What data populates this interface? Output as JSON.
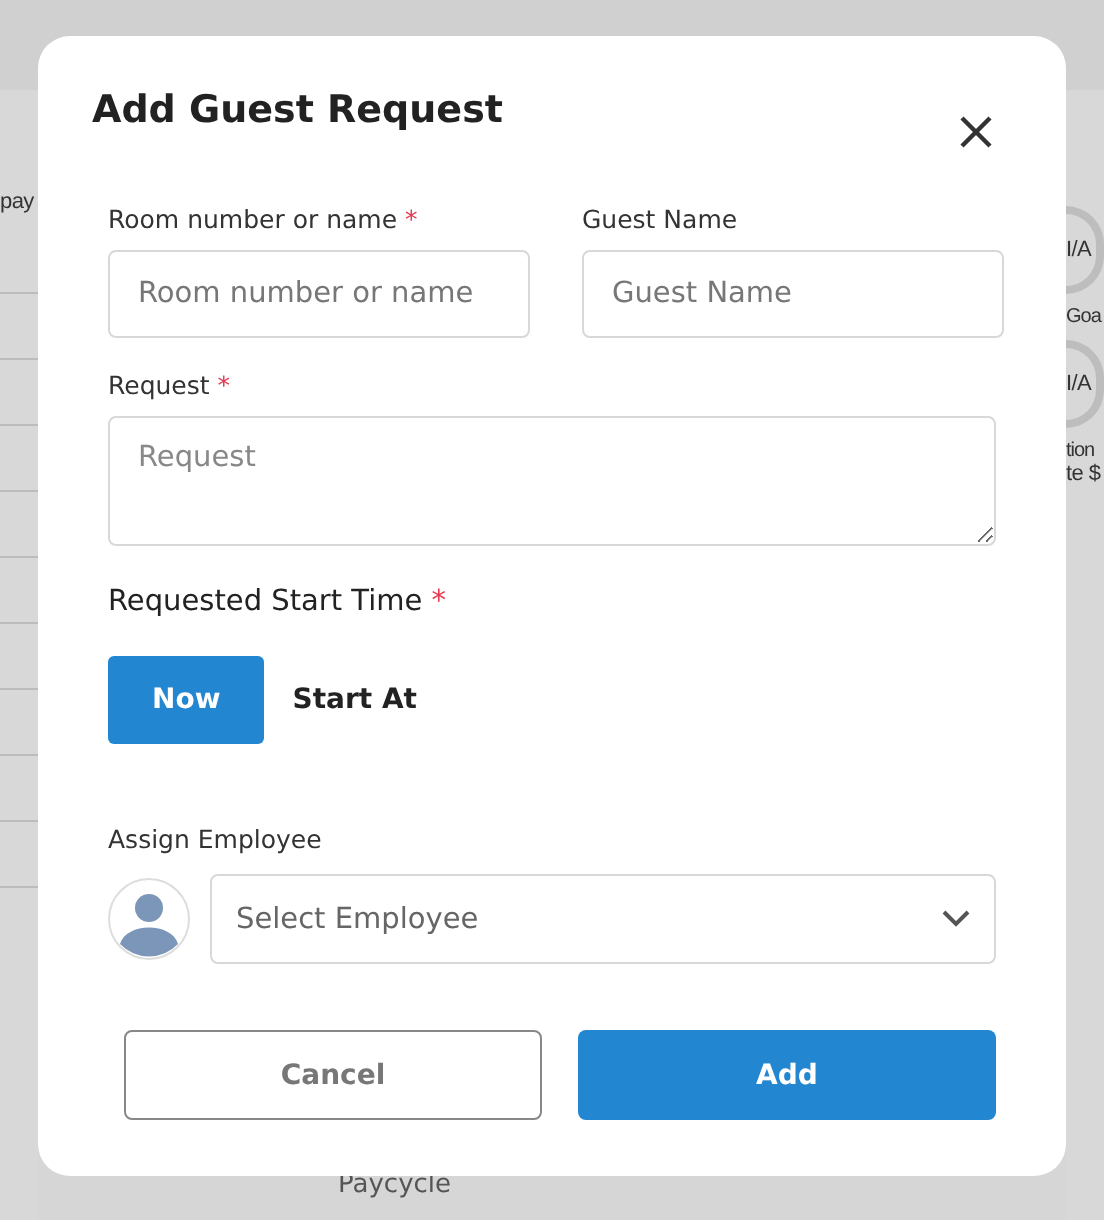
{
  "background": {
    "left_label": "pay",
    "stats": [
      {
        "value": "I/A",
        "caption": "Goa"
      },
      {
        "value": "I/A",
        "caption": "tion"
      }
    ],
    "note": "te $",
    "bottom_label": "Paycycle"
  },
  "dialog": {
    "title": "Add Guest Request",
    "fields": [
      {
        "kind": "input",
        "label": "Room number or name",
        "required_mark": "*",
        "placeholder": "Room number or name"
      },
      {
        "kind": "input",
        "label": "Guest Name",
        "placeholder": "Guest Name"
      },
      {
        "kind": "textarea",
        "label": "Request",
        "required_mark": "*",
        "placeholder": "Request"
      }
    ],
    "start_time": {
      "label": "Requested Start Time",
      "required_mark": "*",
      "options": [
        {
          "label": "Now",
          "selected": true
        },
        {
          "label": "Start At",
          "selected": false
        }
      ]
    },
    "employee": {
      "label": "Assign Employee",
      "placeholder": "Select Employee"
    },
    "buttons": [
      {
        "kind": "secondary",
        "label": "Cancel"
      },
      {
        "kind": "primary",
        "label": "Add"
      }
    ]
  }
}
